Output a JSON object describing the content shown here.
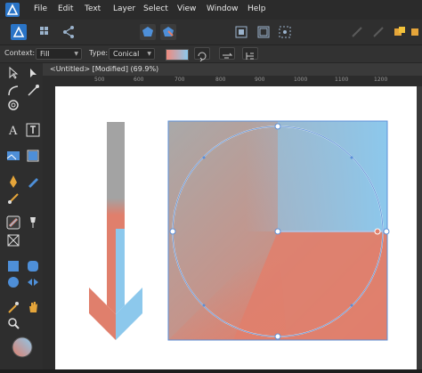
{
  "menu": {
    "items": [
      "File",
      "Edit",
      "Text",
      "Layer",
      "Select",
      "View",
      "Window",
      "Help"
    ]
  },
  "context": {
    "label": "Context:",
    "context_value": "Fill",
    "type_label": "Type:",
    "type_value": "Conical"
  },
  "document": {
    "tab_title": "<Untitled> [Modified] (69.9%)"
  },
  "ruler": {
    "ticks": [
      "500",
      "600",
      "700",
      "800",
      "900",
      "1000",
      "1100",
      "1200"
    ]
  },
  "colors": {
    "gradient_blue": "#8cc8ec",
    "gradient_coral": "#e07f6c",
    "gradient_gray": "#a3a3a3",
    "selection": "#5b8fd8"
  }
}
